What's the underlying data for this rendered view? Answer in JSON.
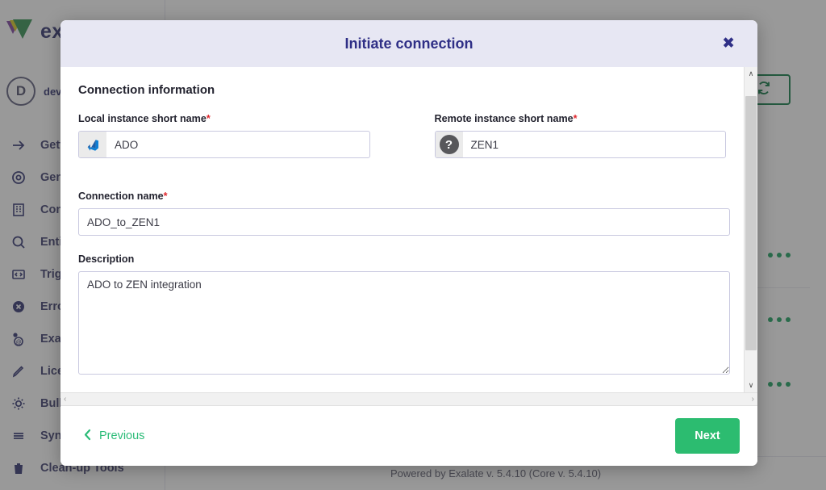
{
  "background": {
    "brand_name": "exa",
    "account_name": "dev.azu",
    "avatar_initial": "D",
    "nav_items": [
      {
        "label": "Getting",
        "icon": "arrow-right-icon"
      },
      {
        "label": "General",
        "icon": "target-icon"
      },
      {
        "label": "Conne",
        "icon": "building-icon"
      },
      {
        "label": "Entity S",
        "icon": "search-icon"
      },
      {
        "label": "Trigger",
        "icon": "code-icon"
      },
      {
        "label": "Errors",
        "icon": "error-circle-icon"
      },
      {
        "label": "Exalate",
        "icon": "mail-icon"
      },
      {
        "label": "License",
        "icon": "pencil-icon"
      },
      {
        "label": "Bulk C",
        "icon": "gear-icon"
      },
      {
        "label": "Sync Q",
        "icon": "list-icon"
      },
      {
        "label": "Clean-up Tools",
        "icon": "trash-icon"
      }
    ],
    "refresh_icon": "refresh-icon",
    "row_menu_icon": "more-options-icon",
    "powered_by": "Powered by Exalate v. 5.4.10 (Core v. 5.4.10)"
  },
  "modal": {
    "title": "Initiate connection",
    "close_label": "✖",
    "section_title": "Connection information",
    "fields": {
      "local_instance": {
        "label": "Local instance short name",
        "required_mark": "*",
        "value": "ADO",
        "placeholder": "",
        "icon": "azure-devops-icon"
      },
      "remote_instance": {
        "label": "Remote instance short name",
        "required_mark": "*",
        "value": "ZEN1",
        "placeholder": "",
        "icon": "question-mark-icon"
      },
      "connection_name": {
        "label": "Connection name",
        "required_mark": "*",
        "value": "ADO_to_ZEN1",
        "placeholder": ""
      },
      "description": {
        "label": "Description",
        "value": "ADO to ZEN integration",
        "placeholder": ""
      }
    },
    "footer": {
      "previous_label": "Previous",
      "previous_icon": "chevron-left-icon",
      "next_label": "Next"
    },
    "scroll": {
      "left_arrow": "‹",
      "right_arrow": "›",
      "up_arrow": "∧",
      "down_arrow": "∨"
    }
  },
  "colors": {
    "accent_green": "#2cbc70",
    "brand_navy": "#2d2f6e",
    "header_bg": "#e7e7f3",
    "required_red": "#e0282e"
  }
}
